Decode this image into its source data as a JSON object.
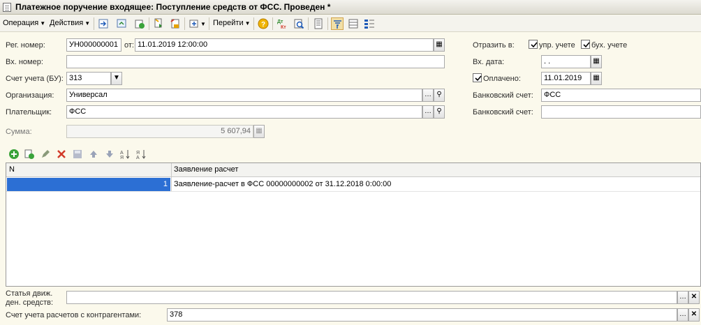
{
  "window": {
    "title": "Платежное поручение входящее: Поступление средств от ФСС. Проведен *"
  },
  "toolbar": {
    "operation_label": "Операция",
    "actions_label": "Действия",
    "goto_label": "Перейти",
    "icons": [
      "post-icon",
      "refresh-icon",
      "copy-icon",
      "print-icon",
      "move-icon",
      "help-icon",
      "dt-kt-icon",
      "preview-icon",
      "structure-icon",
      "filter-icon",
      "list-icon",
      "settings-icon"
    ]
  },
  "form": {
    "reg_label": "Рег. номер:",
    "reg_value": "УН000000001",
    "from_label": "от:",
    "date_value": "11.01.2019 12:00:00",
    "in_num_label": "Вх. номер:",
    "in_num_value": "",
    "account_label": "Счет учета (БУ):",
    "account_value": "313",
    "org_label": "Организация:",
    "org_value": "Универсал",
    "payer_label": "Плательщик:",
    "payer_value": "ФСС",
    "sum_label": "Сумма:",
    "sum_value": "5 607,94",
    "reflect_label": "Отразить в:",
    "upr_label": "упр. учете",
    "buh_label": "бух. учете",
    "in_date_label": "Вх. дата:",
    "in_date_value": " .  .",
    "paid_label": "Оплачено:",
    "paid_date": "11.01.2019",
    "bank_label": "Банковский счет:",
    "bank_value": "ФСС",
    "bank2_label": "Банковский счет:",
    "bank2_value": ""
  },
  "table": {
    "columns": [
      "N",
      "Заявление расчет"
    ],
    "rows": [
      {
        "n": "1",
        "statement": "Заявление-расчет в ФСС 00000000002 от 31.12.2018 0:00:00"
      }
    ]
  },
  "bottom": {
    "cash_flow_label_1": "Статья движ.",
    "cash_flow_label_2": "ден. средств:",
    "cash_flow_value": "",
    "contractor_account_label": "Счет учета расчетов с контрагентами:",
    "contractor_account_value": "378"
  },
  "colors": {
    "background": "#fbf9ec",
    "selection": "#2c6fd4",
    "add_green": "#3aa33a",
    "delete_red": "#d23a2a"
  }
}
